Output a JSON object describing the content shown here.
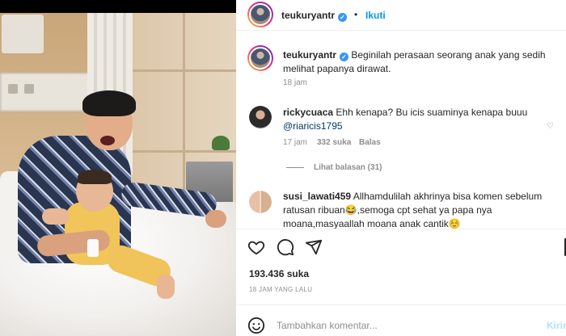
{
  "post_header": {
    "username": "teukuryantr",
    "follow_label": "Ikuti",
    "separator": "•"
  },
  "caption": {
    "username": "teukuryantr",
    "text": "Beginilah perasaan seorang anak yang sedih melihat papanya dirawat.",
    "time": "18 jam"
  },
  "comments": [
    {
      "username": "rickycuaca",
      "text": "Ehh kenapa? Bu icis suaminya kenapa buuu",
      "mention": "@riaricis1795",
      "time": "17 jam",
      "likes": "332 suka",
      "reply_label": "Balas",
      "view_replies": "Lihat balasan (31)"
    },
    {
      "username": "susi_lawati459",
      "text": "Allhamdulilah akhrinya bisa komen sebelum ratusan ribuan😂,semoga cpt sehat ya papa nya moana,masyaallah moana anak cantik☺️"
    }
  ],
  "actions": {
    "like_icon": "heart-icon",
    "comment_icon": "comment-icon",
    "share_icon": "share-icon"
  },
  "likes_count": "193.436 suka",
  "posted_ago": "18 JAM YANG LALU",
  "add_comment": {
    "emoji_icon": "emoji-icon",
    "placeholder": "Tambahkan komentar...",
    "post_label": "Kirim"
  },
  "colors": {
    "accent": "#0095f6",
    "verified": "#3897f0",
    "muted_text": "#8e8e8e"
  }
}
